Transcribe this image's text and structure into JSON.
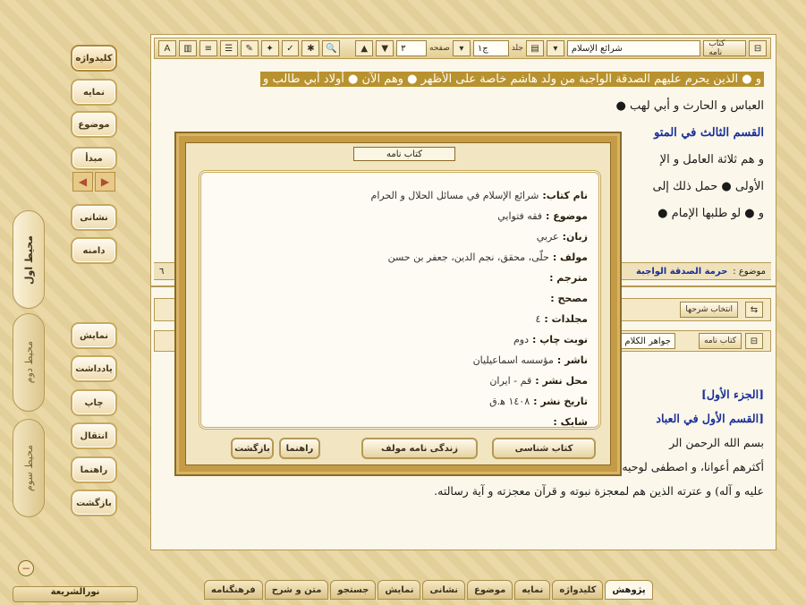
{
  "side_tabs": [
    "محيط اول",
    "محيط دوم",
    "محيط سوم"
  ],
  "left_buttons_top": [
    "كليدواژه",
    "نمايه",
    "موضوع",
    "مبدأ",
    "نشانی",
    "دامنه"
  ],
  "left_buttons_bottom": [
    "نمايش",
    "يادداشت",
    "چاپ",
    "انتقال",
    "راهنما",
    "بازگشت"
  ],
  "toolbar": {
    "book_btn": "كتاب نامه",
    "book_title": "شرائع الإسلام",
    "volume_label": "جلد",
    "volume_value": "ج١",
    "page_label": "صفحه",
    "page_value": "٣"
  },
  "text_lines": [
    "و ● الذين يحرم عليهم الصدقة الواجبة من ولد هاشم خاصة على الأظهر ● وهم الآن ● أولاد أبي طالب و",
    "العباس و الحارث و أبي لهب ●",
    "القسم الثالث في المتو",
    "و هم ثلاثة العامل و الإ",
    "الأولى ● حمل ذلك إلى",
    "و ● لو طلبها الإمام ●"
  ],
  "subject": {
    "label": "موضوع :",
    "value": "حرمة الصدقة الواجبة",
    "page": "٦"
  },
  "lower": {
    "select_btn": "انتخاب شرحها",
    "book_btn": "كتاب نامه",
    "book_title": "جواهر الكلام",
    "text_lines": [
      "[الجزء الأول]",
      "[القسم الأول في العباد",
      "بسم الله الرحمن الر",
      "أكثرهم أعوانا، و اصطفى لوحيه أشرف الأنبياء قبيلة، و أقربهم إليه وسيلة المبعوث آخر الأمم محمد (صلى الله",
      "عليه و آله) و عترته الذين هم لمعجزة نبوته و قرآن معجزته و آية رسالته."
    ]
  },
  "modal": {
    "title": "كتاب نامه",
    "rows": [
      {
        "k": "نام كتاب:",
        "v": "شرائع الإسلام في مسائل الحلال و الحرام"
      },
      {
        "k": "موضوع :",
        "v": "فقه فتوايي"
      },
      {
        "k": "زبان:",
        "v": "عربي"
      },
      {
        "k": "مولف :",
        "v": "حلّی، محقق، نجم الدين، جعفر بن حسن"
      },
      {
        "k": "مترجم :",
        "v": ""
      },
      {
        "k": "مصحح :",
        "v": ""
      },
      {
        "k": "مجلدات :",
        "v": "٤"
      },
      {
        "k": "نوبت چاپ :",
        "v": "دوم"
      },
      {
        "k": "ناشر :",
        "v": "مؤسسه اسماعيليان"
      },
      {
        "k": "محل نشر :",
        "v": "قم - ايران"
      },
      {
        "k": "تاريخ نشر :",
        "v": "١٤٠٨ ه‍.ق"
      },
      {
        "k": "شابک :",
        "v": ""
      }
    ],
    "buttons": {
      "back": "بازگشت",
      "help": "راهنما",
      "author_bio": "زندگی نامه مولف",
      "bibliography": "كتاب شناسی"
    }
  },
  "bottom_tabs": [
    "فرهنگنامه",
    "متن و شرح",
    "جستجو",
    "نمايش",
    "نشانی",
    "موضوع",
    "نمايه",
    "كليدواژه",
    "پژوهش"
  ],
  "brand": "نورالشريعة",
  "colors": {
    "accent": "#b8922e",
    "heading": "#1a2f9a",
    "bullet": "#c8451f"
  }
}
